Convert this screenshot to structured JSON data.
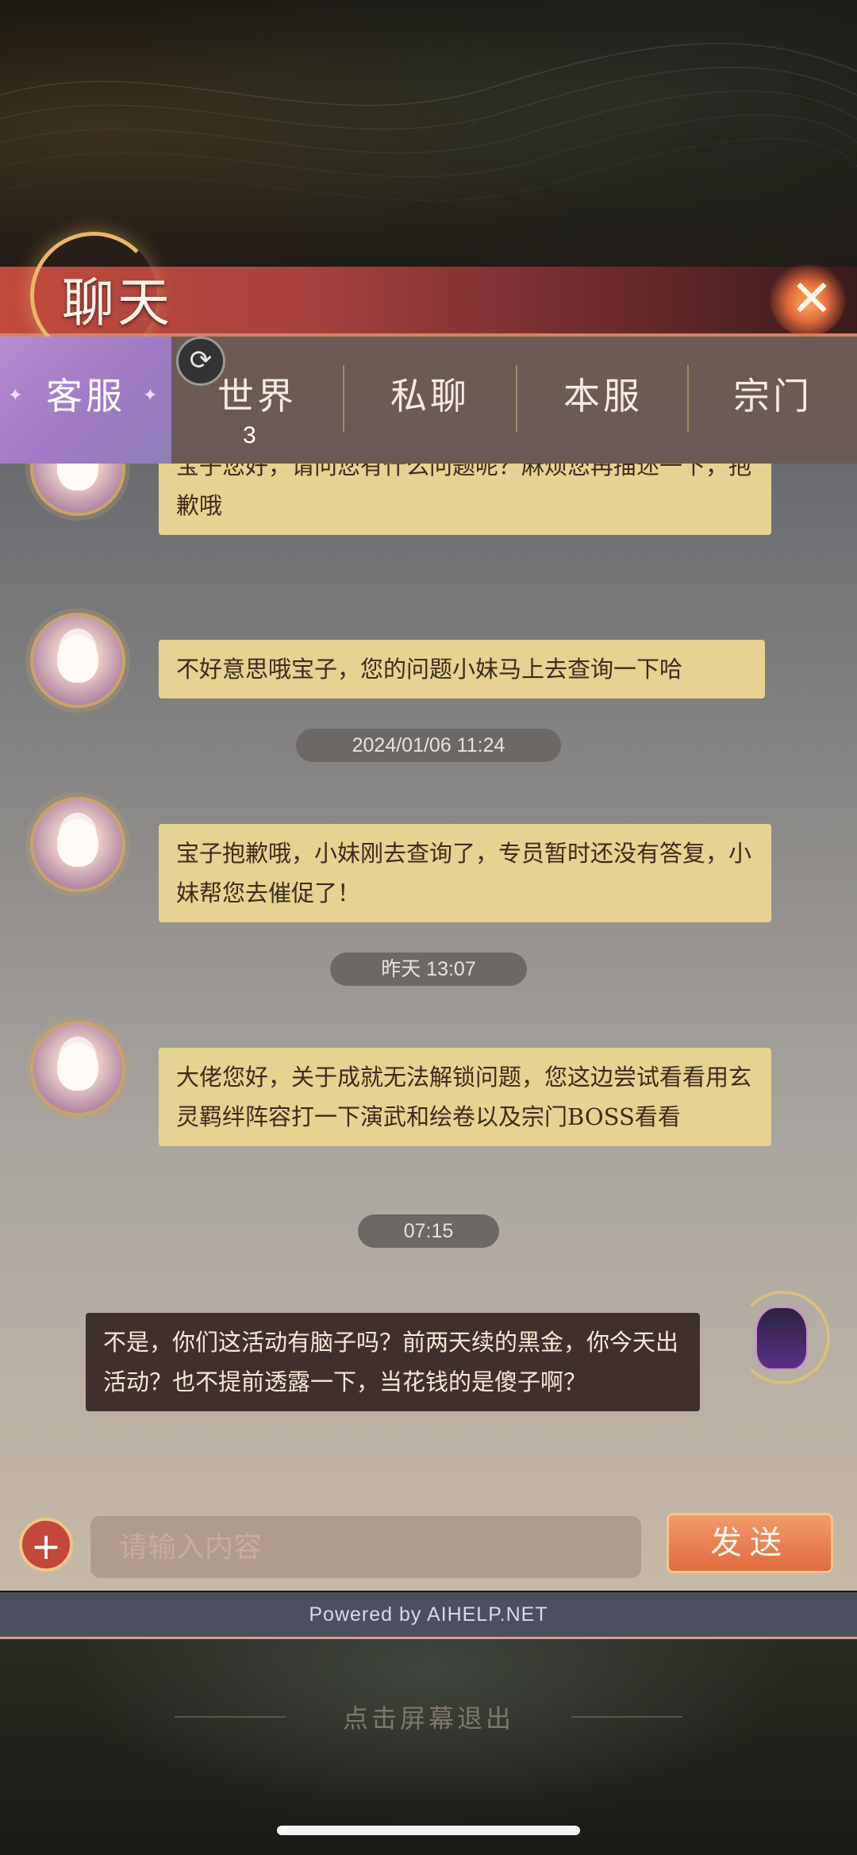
{
  "header": {
    "title": "聊天"
  },
  "tabs": [
    {
      "label": "客服"
    },
    {
      "label": "世界",
      "badge": "3"
    },
    {
      "label": "私聊"
    },
    {
      "label": "本服"
    },
    {
      "label": "宗门"
    }
  ],
  "messages": [
    {
      "from": "service",
      "text": "宝子您好，请问您有什么问题呢？麻烦您再描述一下，抱歉哦"
    },
    {
      "from": "service",
      "text": "不好意思哦宝子，您的问题小妹马上去查询一下哈"
    },
    {
      "type": "time",
      "text": "2024/01/06 11:24"
    },
    {
      "from": "service",
      "text": "宝子抱歉哦，小妹刚去查询了，专员暂时还没有答复，小妹帮您去催促了！"
    },
    {
      "type": "time",
      "text": "昨天 13:07"
    },
    {
      "from": "service",
      "text": "大佬您好，关于成就无法解锁问题，您这边尝试看看用玄灵羁绊阵容打一下演武和绘卷以及宗门BOSS看看"
    },
    {
      "type": "time",
      "text": "07:15"
    },
    {
      "from": "me",
      "text": "不是，你们这活动有脑子吗？前两天续的黑金，你今天出活动？也不提前透露一下，当花钱的是傻子啊？"
    }
  ],
  "input": {
    "placeholder": "请输入内容",
    "value": ""
  },
  "send_label": "发送",
  "footer": {
    "powered_by": "Powered by AIHELP.NET",
    "exit_hint": "点击屏幕退出"
  },
  "colors": {
    "service_bubble": "#e6d291",
    "my_bubble": "#3e302c",
    "active_tab": "#b68ad0",
    "title_band": "#c24a3d"
  }
}
